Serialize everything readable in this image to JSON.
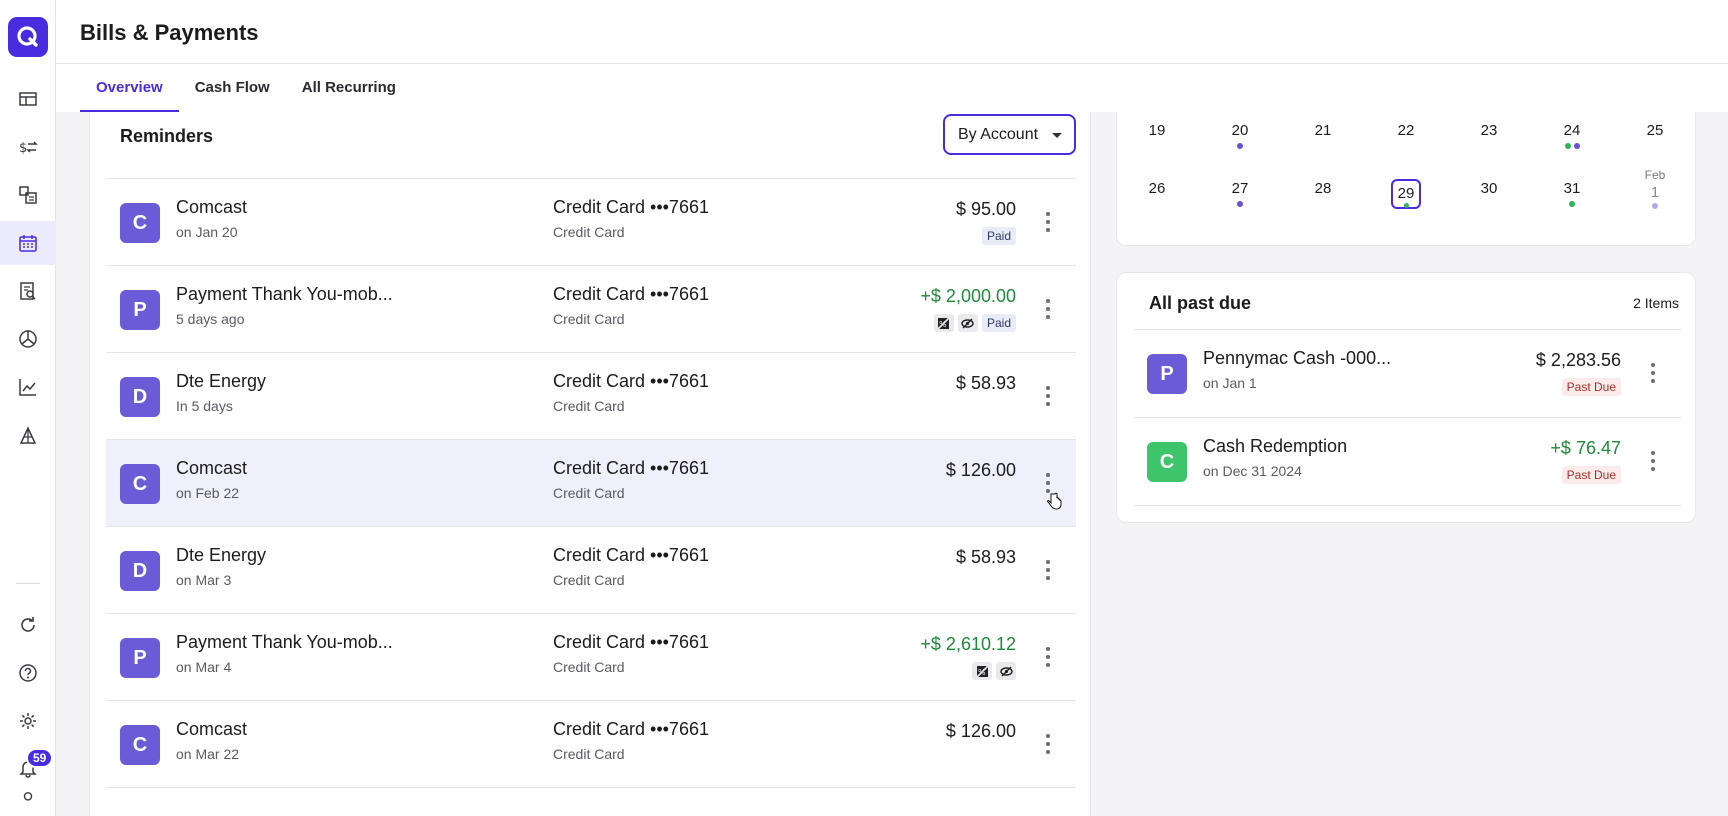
{
  "app": {
    "page_title": "Bills & Payments",
    "notification_count": "59"
  },
  "tabs": [
    {
      "label": "Overview",
      "active": true
    },
    {
      "label": "Cash Flow",
      "active": false
    },
    {
      "label": "All Recurring",
      "active": false
    }
  ],
  "reminders": {
    "title": "Reminders",
    "filter_label": "By Account",
    "rows": [
      {
        "initial": "C",
        "payee": "Comcast",
        "date": "on Jan 20",
        "account": "Credit Card •••7661",
        "account_type": "Credit Card",
        "amount": "$ 95.00",
        "status": "Paid"
      },
      {
        "initial": "P",
        "payee": "Payment Thank You-mob...",
        "date": "5 days ago",
        "account": "Credit Card •••7661",
        "account_type": "Credit Card",
        "amount": "+$ 2,000.00",
        "status": "Paid"
      },
      {
        "initial": "D",
        "payee": "Dte Energy",
        "date": "In 5 days",
        "account": "Credit Card •••7661",
        "account_type": "Credit Card",
        "amount": "$ 58.93"
      },
      {
        "initial": "C",
        "payee": "Comcast",
        "date": "on Feb 22",
        "account": "Credit Card •••7661",
        "account_type": "Credit Card",
        "amount": "$ 126.00"
      },
      {
        "initial": "D",
        "payee": "Dte Energy",
        "date": "on Mar 3",
        "account": "Credit Card •••7661",
        "account_type": "Credit Card",
        "amount": "$ 58.93"
      },
      {
        "initial": "P",
        "payee": "Payment Thank You-mob...",
        "date": "on Mar 4",
        "account": "Credit Card •••7661",
        "account_type": "Credit Card",
        "amount": "+$ 2,610.12"
      },
      {
        "initial": "C",
        "payee": "Comcast",
        "date": "on Mar 22",
        "account": "Credit Card •••7661",
        "account_type": "Credit Card",
        "amount": "$ 126.00"
      }
    ]
  },
  "calendar": {
    "week1": [
      "19",
      "20",
      "21",
      "22",
      "23",
      "24",
      "25"
    ],
    "week2": [
      "26",
      "27",
      "28",
      "29",
      "30",
      "31",
      "1"
    ],
    "next_month_label": "Feb",
    "today": "29"
  },
  "past_due": {
    "title": "All past due",
    "count_label": "2 Items",
    "rows": [
      {
        "initial": "P",
        "payee": "Pennymac Cash -000...",
        "date": "on Jan 1",
        "amount": "$ 2,283.56",
        "status": "Past Due"
      },
      {
        "initial": "C",
        "payee": "Cash Redemption",
        "date": "on Dec 31 2024",
        "amount": "+$ 76.47",
        "status": "Past Due"
      }
    ]
  },
  "colors": {
    "accent": "#4a2ce0",
    "avatar_purple": "#6b5bd6",
    "avatar_green": "#3ec46a",
    "positive_amount": "#1f8a3a",
    "dot_purple": "#6b4fd8",
    "dot_green": "#2fb35a"
  }
}
